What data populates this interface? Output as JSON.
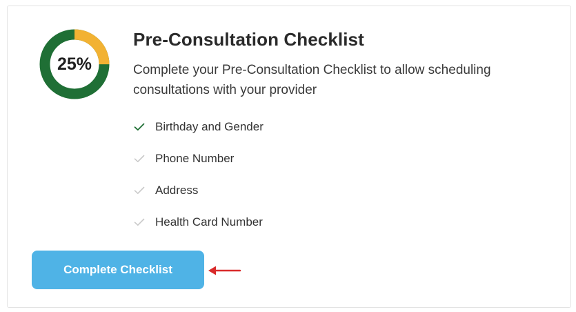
{
  "progress": {
    "percent_value": 25,
    "label": "25%",
    "colors": {
      "complete": "#f2b233",
      "remaining": "#1f6f35"
    }
  },
  "header": {
    "title": "Pre-Consultation Checklist",
    "description": "Complete your Pre-Consultation Checklist to allow scheduling consultations with your provider"
  },
  "checklist": {
    "items": [
      {
        "label": "Birthday and Gender",
        "completed": true,
        "icon": "check-icon"
      },
      {
        "label": "Phone Number",
        "completed": false,
        "icon": "check-icon"
      },
      {
        "label": "Address",
        "completed": false,
        "icon": "check-icon"
      },
      {
        "label": "Health Card Number",
        "completed": false,
        "icon": "check-icon"
      }
    ],
    "colors": {
      "done": "#1f6f35",
      "pending": "#c9c9c9"
    }
  },
  "actions": {
    "complete_label": "Complete Checklist",
    "button_color": "#4fb3e6"
  },
  "annotation": {
    "icon": "red-arrow-icon",
    "color": "#d92b2b"
  }
}
